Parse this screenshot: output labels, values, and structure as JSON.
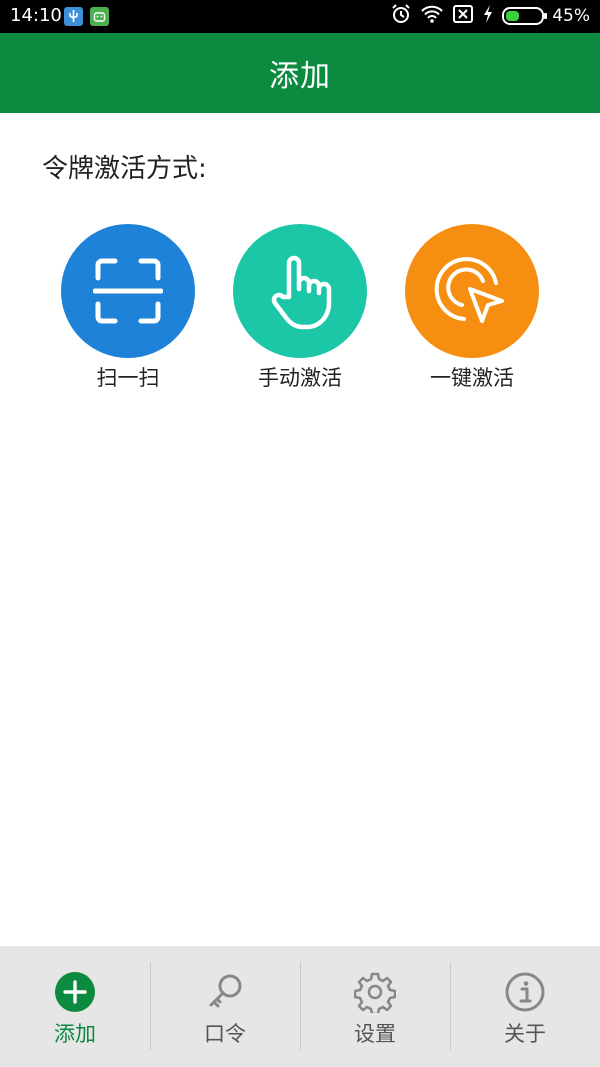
{
  "status_bar": {
    "time": "14:10",
    "battery_percent_text": "45%",
    "battery_level": 0.45,
    "icons": [
      "usb-icon",
      "android-icon",
      "alarm-icon",
      "wifi-icon",
      "no-sim-icon",
      "charging-icon",
      "battery-icon"
    ]
  },
  "header": {
    "title": "添加"
  },
  "content": {
    "section_title": "令牌激活方式:",
    "methods": [
      {
        "label": "扫一扫",
        "icon": "scan-icon",
        "color": "#1e82d8"
      },
      {
        "label": "手动激活",
        "icon": "hand-pointer-icon",
        "color": "#1cc7a8"
      },
      {
        "label": "一键激活",
        "icon": "cursor-click-icon",
        "color": "#f68f11"
      }
    ]
  },
  "bottom_nav": {
    "active_color": "#0c8a3f",
    "items": [
      {
        "label": "添加",
        "icon": "add-circle-icon",
        "active": true
      },
      {
        "label": "口令",
        "icon": "key-icon",
        "active": false
      },
      {
        "label": "设置",
        "icon": "gear-icon",
        "active": false
      },
      {
        "label": "关于",
        "icon": "info-icon",
        "active": false
      }
    ]
  }
}
